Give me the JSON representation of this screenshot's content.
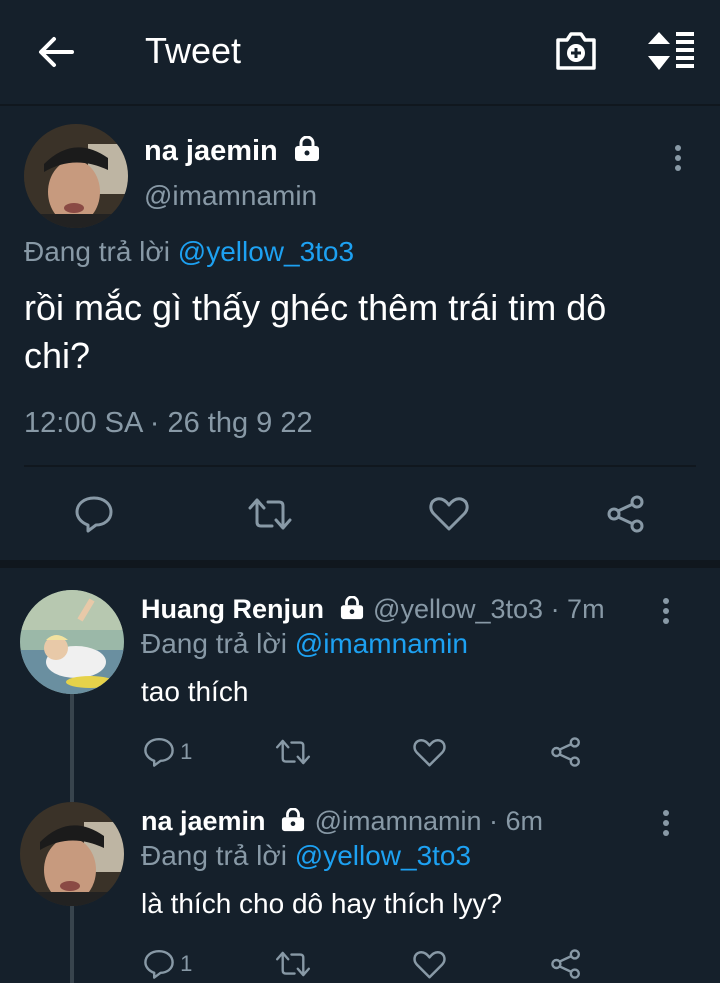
{
  "header": {
    "title": "Tweet"
  },
  "main_tweet": {
    "name": "na jaemin",
    "handle": "@imamnamin",
    "reply_prefix": "Đang trả lời",
    "reply_to": "@yellow_3to3",
    "text_line1": "rồi mắc gì thấy ghéc thêm trái tim dô",
    "text_line2": "chi?",
    "timestamp": "12:00 SA · 26 thg 9 22"
  },
  "replies": [
    {
      "name": "Huang Renjun",
      "handle": "@yellow_3to3",
      "time": "· 7m",
      "reply_prefix": "Đang trả lời",
      "reply_to": "@imamnamin",
      "text": "tao thích",
      "reply_count": "1"
    },
    {
      "name": "na jaemin",
      "handle": "@imamnamin",
      "time": "· 6m",
      "reply_prefix": "Đang trả lời",
      "reply_to": "@yellow_3to3",
      "text": "là thích cho dô hay thích lyy?",
      "reply_count": "1"
    }
  ],
  "colors": {
    "background": "#15202b",
    "accent": "#1da1f2",
    "muted": "#8899a6",
    "text": "#ffffff"
  },
  "icons": [
    "back-arrow-icon",
    "camera-add-icon",
    "sort-icon",
    "lock-icon",
    "more-vertical-icon",
    "reply-icon",
    "retweet-icon",
    "like-icon",
    "share-icon"
  ]
}
